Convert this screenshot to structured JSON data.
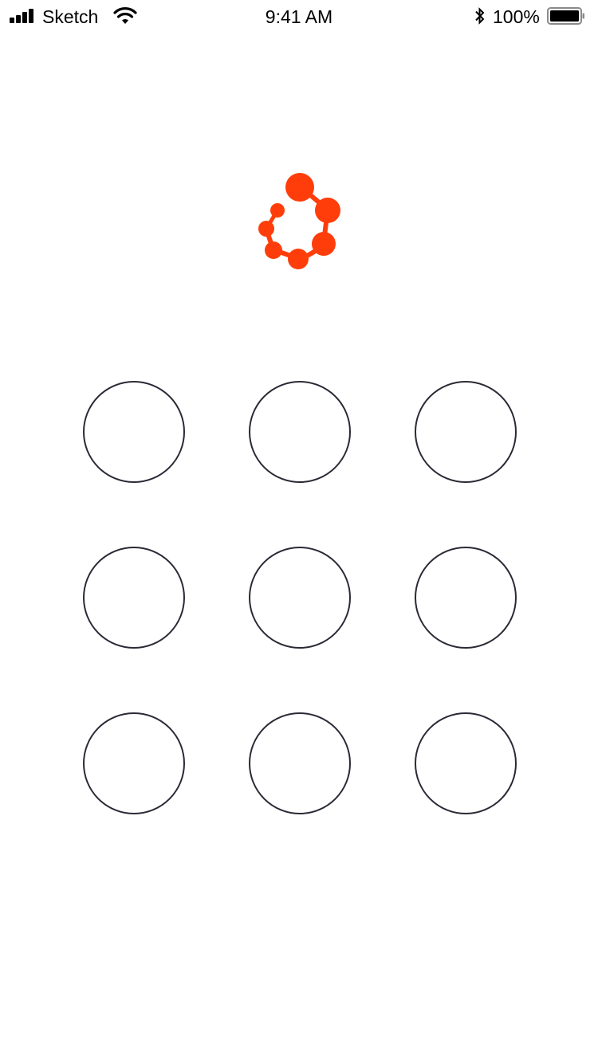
{
  "status_bar": {
    "carrier": "Sketch",
    "time": "9:41 AM",
    "battery_percent": "100%",
    "signal_icon": "signal-bars-icon",
    "wifi_icon": "wifi-icon",
    "bluetooth_icon": "bluetooth-icon",
    "battery_icon": "battery-icon"
  },
  "logo": {
    "icon": "molecule-ring-logo-icon",
    "color": "#ff3d0a"
  },
  "pattern_lock": {
    "rows": 3,
    "columns": 3,
    "dots": [
      {
        "id": "1",
        "selected": false
      },
      {
        "id": "2",
        "selected": false
      },
      {
        "id": "3",
        "selected": false
      },
      {
        "id": "4",
        "selected": false
      },
      {
        "id": "5",
        "selected": false
      },
      {
        "id": "6",
        "selected": false
      },
      {
        "id": "7",
        "selected": false
      },
      {
        "id": "8",
        "selected": false
      },
      {
        "id": "9",
        "selected": false
      }
    ],
    "ring_color": "#2a2a36"
  }
}
